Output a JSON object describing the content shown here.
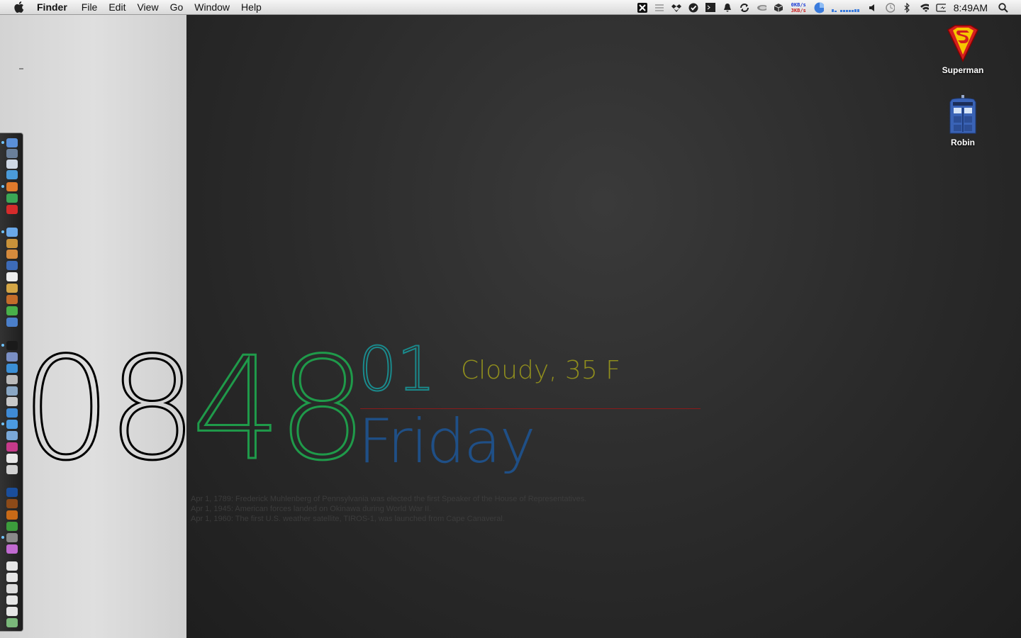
{
  "menubar": {
    "app_name": "Finder",
    "menus": [
      "File",
      "Edit",
      "View",
      "Go",
      "Window",
      "Help"
    ],
    "netspeed_up": "0KB/s",
    "netspeed_down": "3KB/s",
    "clock": "8:49AM"
  },
  "widget": {
    "hour": "08",
    "minute": "48",
    "seconds": "01",
    "weather": "Cloudy, 35 F",
    "day": "Friday",
    "history": [
      "Apr 1, 1789: Frederick Muhlenberg of Pennsylvania was elected the first Speaker of the House of Representatives.",
      "Apr 1, 1945: American forces landed on Okinawa during World War II.",
      "Apr 1, 1960: The first U.S. weather satellite, TIROS-1, was launched from Cape Canaveral."
    ],
    "colors": {
      "hour": "#000000",
      "minute": "#1f9a4a",
      "seconds": "#1a8a8c",
      "weather": "#8f8d1d",
      "divider": "#8b1a1a",
      "day": "#1f4f86"
    }
  },
  "desktop_icons": [
    {
      "label": "Superman",
      "icon": "superman-shield-icon"
    },
    {
      "label": "Robin",
      "icon": "police-box-icon"
    }
  ],
  "dock": {
    "icons": [
      "finder-icon",
      "mission-control-icon",
      "dashboard-icon",
      "safari-icon",
      "firefox-icon",
      "chrome-icon",
      "opera-icon",
      "itunes-icon",
      "archive-icon",
      "app-icon",
      "preview-icon",
      "app-icon",
      "app-icon",
      "app-icon",
      "utorrent-icon",
      "app-icon",
      "terminal-icon",
      "app-icon",
      "app-icon",
      "app-icon",
      "app-icon",
      "app-icon",
      "app-icon",
      "app-icon",
      "app-icon",
      "app-icon",
      "app-icon",
      "app-icon",
      "photoshop-icon",
      "bridge-icon",
      "illustrator-icon",
      "app-icon",
      "app-icon",
      "app-icon",
      "folder-icon",
      "folder-icon",
      "camera-icon",
      "folder-icon",
      "folder-icon",
      "trash-icon"
    ]
  }
}
